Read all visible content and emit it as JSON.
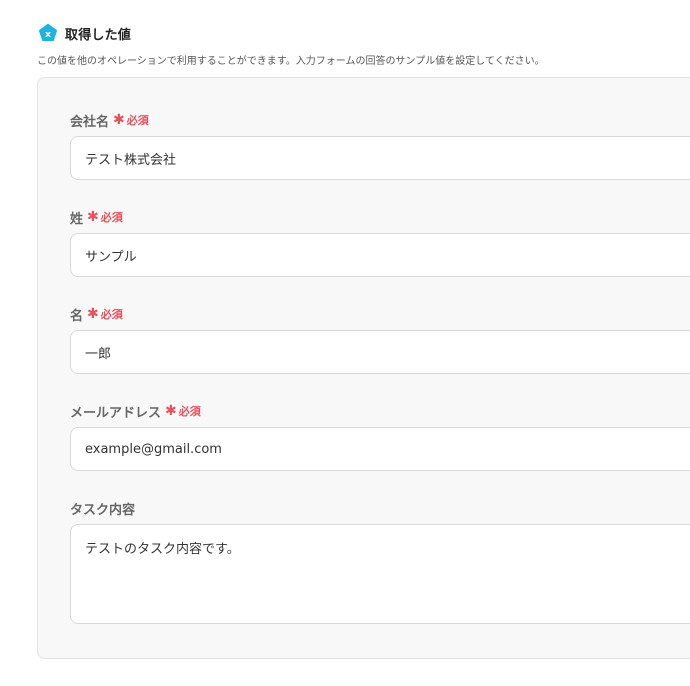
{
  "header": {
    "title": "取得した値",
    "icon": "variable-x-icon",
    "icon_color": "#1eb3e0"
  },
  "description": "この値を他のオペレーションで利用することができます。入力フォームの回答のサンプル値を設定してください。",
  "required_star": "✱",
  "required_text": "必須",
  "accent_color": "#e8505b",
  "fields": [
    {
      "label": "会社名",
      "required": true,
      "value": "テスト株式会社"
    },
    {
      "label": "姓",
      "required": true,
      "value": "サンプル"
    },
    {
      "label": "名",
      "required": true,
      "value": "一郎"
    },
    {
      "label": "メールアドレス",
      "required": true,
      "value": "example@gmail.com"
    },
    {
      "label": "タスク内容",
      "required": false,
      "value": "テストのタスク内容です。"
    }
  ]
}
